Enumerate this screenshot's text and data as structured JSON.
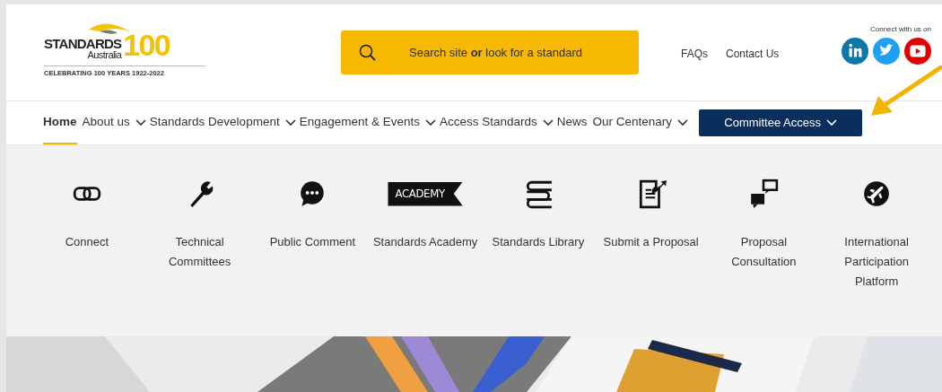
{
  "logo": {
    "name": "STANDARDS",
    "sub": "Australia",
    "centenary": "100",
    "tagline": "CELEBRATING 100 YEARS 1922-2022"
  },
  "search": {
    "placeholder": "Search site **or** look for a standard"
  },
  "header_links": [
    "FAQs",
    "Contact Us"
  ],
  "social": {
    "label": "Connect with us on",
    "icons": [
      {
        "kind": "linkedin",
        "color": "#0e76a8"
      },
      {
        "kind": "twitter",
        "color": "#1da1f2"
      },
      {
        "kind": "youtube",
        "color": "#e00000"
      }
    ]
  },
  "nav": [
    {
      "label": "Home",
      "selected": true,
      "dropdown": false
    },
    {
      "label": "About us",
      "selected": false,
      "dropdown": true
    },
    {
      "label": "Standards Development",
      "selected": false,
      "dropdown": true
    },
    {
      "label": "Engagement & Events",
      "selected": false,
      "dropdown": true
    },
    {
      "label": "Access Standards",
      "selected": false,
      "dropdown": true
    },
    {
      "label": "News",
      "selected": false,
      "dropdown": false
    },
    {
      "label": "Our Centenary",
      "selected": false,
      "dropdown": true
    }
  ],
  "nav_button": {
    "label": "Committee Access"
  },
  "menu": [
    {
      "kind": "link",
      "label": "Connect"
    },
    {
      "kind": "wrench",
      "label": "Technical Committees"
    },
    {
      "kind": "comment",
      "label": "Public Comment"
    },
    {
      "kind": "academy",
      "label": "Standards Academy",
      "badge": "ACADEMY"
    },
    {
      "kind": "books",
      "label": "Standards Library"
    },
    {
      "kind": "document",
      "label": "Submit a Proposal"
    },
    {
      "kind": "chats",
      "label": "Proposal Consultation"
    },
    {
      "kind": "globe",
      "label": "International Participation Platform"
    }
  ],
  "banner": {
    "kind": "picture"
  }
}
